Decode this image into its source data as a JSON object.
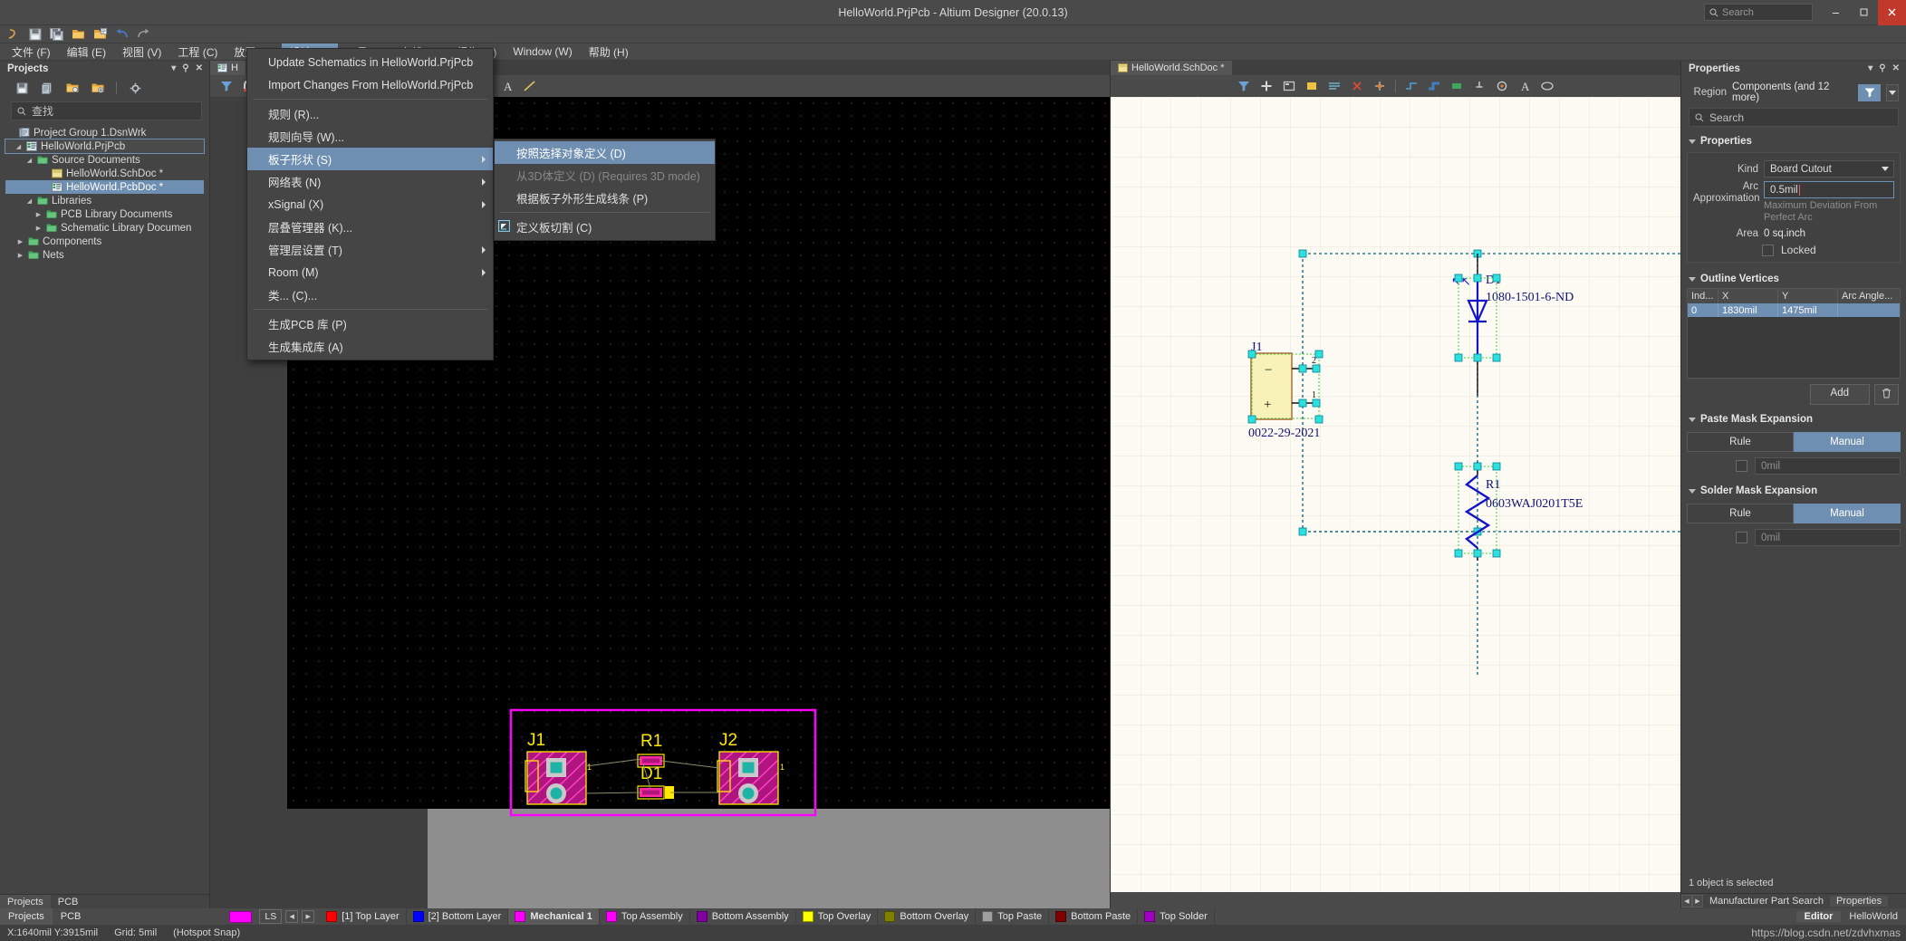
{
  "titlebar": {
    "title": "HelloWorld.PrjPcb - Altium Designer (20.0.13)",
    "search_placeholder": "Search",
    "minimize": "–",
    "maximize": "□",
    "close": "✕"
  },
  "menubar": [
    {
      "label": "文件 (F)",
      "key": "F"
    },
    {
      "label": "编辑 (E)",
      "key": "E"
    },
    {
      "label": "视图 (V)",
      "key": "V"
    },
    {
      "label": "工程 (C)",
      "key": "C"
    },
    {
      "label": "放置 (P)",
      "key": "P"
    },
    {
      "label": "设计 (D)",
      "key": "D",
      "active": true
    },
    {
      "label": "工具 (T)",
      "key": "T"
    },
    {
      "label": "布线 (U)",
      "key": "U"
    },
    {
      "label": "报告 (R)",
      "key": "R"
    },
    {
      "label": "Window (W)",
      "key": "W"
    },
    {
      "label": "帮助 (H)",
      "key": "H"
    }
  ],
  "design_menu": {
    "items": [
      {
        "label": "Update Schematics in HelloWorld.PrjPcb",
        "type": "item"
      },
      {
        "label": "Import Changes From HelloWorld.PrjPcb",
        "type": "item"
      },
      {
        "type": "sep"
      },
      {
        "label": "规则 (R)...",
        "type": "item"
      },
      {
        "label": "规则向导 (W)...",
        "type": "item"
      },
      {
        "label": "板子形状 (S)",
        "type": "submenu",
        "selected": true
      },
      {
        "label": "网络表 (N)",
        "type": "submenu"
      },
      {
        "label": "xSignal (X)",
        "type": "submenu"
      },
      {
        "label": "层叠管理器 (K)...",
        "type": "item"
      },
      {
        "label": "管理层设置 (T)",
        "type": "submenu"
      },
      {
        "label": "Room (M)",
        "type": "submenu"
      },
      {
        "label": "类... (C)...",
        "type": "item"
      },
      {
        "type": "sep"
      },
      {
        "label": "生成PCB 库 (P)",
        "type": "item"
      },
      {
        "label": "生成集成库 (A)",
        "type": "item"
      }
    ]
  },
  "board_shape_submenu": {
    "items": [
      {
        "label": "按照选择对象定义 (D)",
        "selected": true,
        "disabled": false,
        "icon": false
      },
      {
        "label": "从3D体定义 (D) (Requires 3D mode)",
        "selected": false,
        "disabled": true,
        "icon": false
      },
      {
        "label": "根据板子外形生成线条 (P)",
        "selected": false,
        "disabled": false,
        "icon": false
      },
      {
        "label": "定义板切割 (C)",
        "selected": false,
        "disabled": false,
        "icon": true
      }
    ]
  },
  "projects_panel": {
    "title": "Projects",
    "search_placeholder": "查找",
    "tree": [
      {
        "label": "Project Group 1.DsnWrk",
        "depth": 0,
        "icon": "workspace-icon",
        "twisty": "",
        "state": "none"
      },
      {
        "label": "HelloWorld.PrjPcb",
        "depth": 1,
        "icon": "pcbproject-icon",
        "twisty": "down",
        "state": "outline"
      },
      {
        "label": "Source Documents",
        "depth": 2,
        "icon": "folder-icon",
        "twisty": "down",
        "state": "none"
      },
      {
        "label": "HelloWorld.SchDoc *",
        "depth": 3,
        "icon": "sch-icon",
        "twisty": "",
        "state": "none"
      },
      {
        "label": "HelloWorld.PcbDoc *",
        "depth": 3,
        "icon": "pcb-icon",
        "twisty": "",
        "state": "filled"
      },
      {
        "label": "Libraries",
        "depth": 2,
        "icon": "folder-icon",
        "twisty": "down",
        "state": "none"
      },
      {
        "label": "PCB Library Documents",
        "depth": 3,
        "icon": "folder-icon",
        "twisty": "right",
        "state": "none"
      },
      {
        "label": "Schematic Library Documen",
        "depth": 3,
        "icon": "folder-icon",
        "twisty": "right",
        "state": "none"
      },
      {
        "label": "Components",
        "depth": 2,
        "icon": "folder-icon",
        "twisty": "right",
        "state": "none"
      },
      {
        "label": "Nets",
        "depth": 2,
        "icon": "folder-icon",
        "twisty": "right",
        "state": "none"
      }
    ],
    "bottom_tabs": [
      {
        "label": "Projects",
        "active": true
      },
      {
        "label": "PCB",
        "active": false
      }
    ]
  },
  "pcb_editor": {
    "tab_label": "H",
    "board": {
      "outline_color": "#ff00ff",
      "designators": [
        "J1",
        "R1",
        "J2",
        "D1"
      ],
      "pad_numbers": [
        "1",
        "1"
      ]
    }
  },
  "schematic": {
    "tab_label": "HelloWorld.SchDoc *",
    "components": [
      {
        "designator": "J1",
        "part": "0022-29-2021"
      },
      {
        "designator": "D1",
        "part": "1080-1501-6-ND"
      },
      {
        "designator": "R1",
        "part": "0603WAJ0201T5E"
      }
    ]
  },
  "properties_panel": {
    "title": "Properties",
    "region_label": "Region",
    "region_value": "Components (and 12 more)",
    "search_placeholder": "Search",
    "sections": {
      "properties": {
        "header": "Properties",
        "kind_label": "Kind",
        "kind_value": "Board Cutout",
        "arc_label_line1": "Arc",
        "arc_label_line2": "Approximation",
        "arc_value": "0.5mil",
        "arc_hint_line1": "Maximum Deviation From",
        "arc_hint_line2": "Perfect Arc",
        "area_label": "Area",
        "area_value": "0 sq.inch",
        "locked_label": "Locked"
      },
      "outline_vertices": {
        "header": "Outline Vertices",
        "columns": [
          "Ind...",
          "X",
          "Y",
          "Arc Angle..."
        ],
        "rows": [
          [
            "0",
            "1830mil",
            "1475mil",
            ""
          ]
        ],
        "add_button": "Add",
        "delete_button": "🗑"
      },
      "paste_mask": {
        "header": "Paste Mask Expansion",
        "rule_label": "Rule",
        "manual_label": "Manual",
        "active": "Manual",
        "value": "0mil"
      },
      "solder_mask": {
        "header": "Solder Mask Expansion",
        "rule_label": "Rule",
        "manual_label": "Manual",
        "active": "Manual",
        "value": "0mil"
      }
    },
    "status": "1 object is selected",
    "bottom_tabs": [
      {
        "label": "Manufacturer Part Search",
        "active": false
      },
      {
        "label": "Properties",
        "active": true
      }
    ]
  },
  "layerbar": {
    "ls_button": "LS",
    "active_swatch_color": "#ff00ff",
    "layers": [
      {
        "label": "[1] Top Layer",
        "color": "#ff0000",
        "active": false
      },
      {
        "label": "[2] Bottom Layer",
        "color": "#0000ff",
        "active": false
      },
      {
        "label": "Mechanical 1",
        "color": "#ff00ff",
        "active": true
      },
      {
        "label": "Top Assembly",
        "color": "#ff00ff",
        "active": false
      },
      {
        "label": "Bottom Assembly",
        "color": "#8000a0",
        "active": false
      },
      {
        "label": "Top Overlay",
        "color": "#ffff00",
        "active": false
      },
      {
        "label": "Bottom Overlay",
        "color": "#808000",
        "active": false
      },
      {
        "label": "Top Paste",
        "color": "#a0a0a0",
        "active": false
      },
      {
        "label": "Bottom Paste",
        "color": "#800000",
        "active": false
      },
      {
        "label": "Top Solder",
        "color": "#a000c0",
        "active": false
      }
    ],
    "right_tabs": [
      {
        "label": "Editor",
        "active": true
      },
      {
        "label": "HelloWorld",
        "active": false
      }
    ]
  },
  "statusbar": {
    "coords": "X:1640mil Y:3915mil",
    "grid": "Grid: 5mil",
    "snap": "(Hotspot Snap)"
  },
  "watermark": "https://blog.csdn.net/zdvhxmas"
}
